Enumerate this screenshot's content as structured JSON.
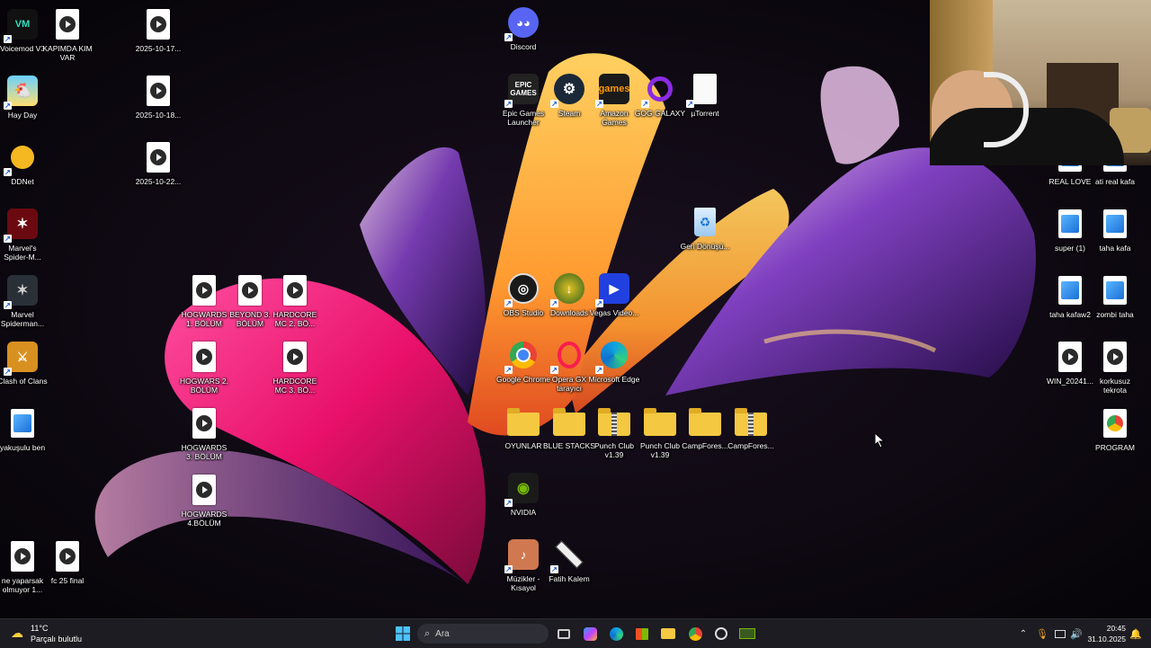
{
  "desktop": {
    "icons": [
      {
        "label": "Voicemod V3"
      },
      {
        "label": "KAPIMDA KIM VAR"
      },
      {
        "label": "2025-10-17..."
      },
      {
        "label": "Discord"
      },
      {
        "label": "Hay Day"
      },
      {
        "label": "2025-10-18..."
      },
      {
        "label": "Epic Games Launcher"
      },
      {
        "label": "Steam"
      },
      {
        "label": "Amazon Games"
      },
      {
        "label": "GOG GALAXY"
      },
      {
        "label": "µTorrent"
      },
      {
        "label": "DDNet"
      },
      {
        "label": "2025-10-22..."
      },
      {
        "label": "REAL LOVE"
      },
      {
        "label": "ati real kafa"
      },
      {
        "label": "Marvel's Spider-M..."
      },
      {
        "label": "Geri Dönüşü..."
      },
      {
        "label": "super (1)"
      },
      {
        "label": "taha kafa"
      },
      {
        "label": "Marvel Spiderman..."
      },
      {
        "label": "HOGWARDS 1. BÖLÜM"
      },
      {
        "label": "BEYOND 3. BÖLÜM"
      },
      {
        "label": "HARDCORE MC 2. BÖ..."
      },
      {
        "label": "OBS Studio"
      },
      {
        "label": "Downloads"
      },
      {
        "label": "Vegas Video..."
      },
      {
        "label": "taha kafaw2"
      },
      {
        "label": "zombi taha"
      },
      {
        "label": "Clash of Clans"
      },
      {
        "label": "HOGWARS 2. BÖLÜM"
      },
      {
        "label": "HARDCORE MC 3. BÖ..."
      },
      {
        "label": "Google Chrome"
      },
      {
        "label": "Opera GX tarayıcı"
      },
      {
        "label": "Microsoft Edge"
      },
      {
        "label": "WIN_20241..."
      },
      {
        "label": "korkusuz tekrota"
      },
      {
        "label": "yakuşulu ben"
      },
      {
        "label": "HOGWARDS 3. BÖLÜM"
      },
      {
        "label": "OYUNLAR"
      },
      {
        "label": "BLUE STACKS"
      },
      {
        "label": "Punch Club v1.39"
      },
      {
        "label": "Punch Club v1.39"
      },
      {
        "label": "CampFores..."
      },
      {
        "label": "CampFores..."
      },
      {
        "label": "PROGRAM"
      },
      {
        "label": "HOGWARDS 4.BÖLÜM"
      },
      {
        "label": "NVIDIA"
      },
      {
        "label": "ne yaparsak olmuyor 1..."
      },
      {
        "label": "fc 25 final"
      },
      {
        "label": "Müzikler - Kısayol"
      },
      {
        "label": "Fatih Kalem"
      }
    ]
  },
  "icon_text": {
    "epic": "EPIC GAMES",
    "amazon": "games"
  },
  "taskbar": {
    "weather_temp": "11°C",
    "weather_desc": "Parçalı bulutlu",
    "search_placeholder": "Ara",
    "time": "20:45",
    "date": "31.10.2025"
  }
}
